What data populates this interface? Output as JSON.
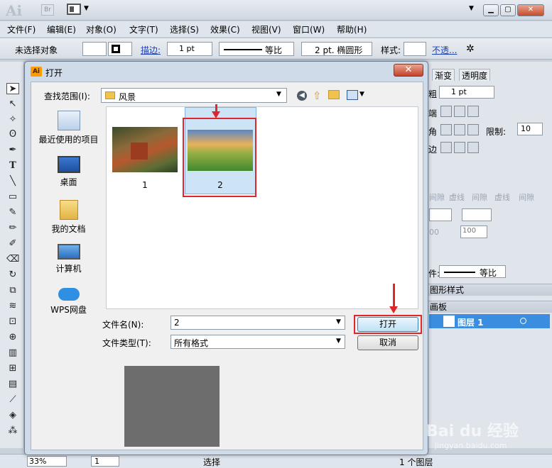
{
  "app": {
    "logo": "Ai",
    "bridge_badge": "Br",
    "window_buttons": [
      "▁",
      "▢",
      "✕"
    ]
  },
  "menu": {
    "items": [
      "文件(F)",
      "编辑(E)",
      "对象(O)",
      "文字(T)",
      "选择(S)",
      "效果(C)",
      "视图(V)",
      "窗口(W)",
      "帮助(H)"
    ]
  },
  "control_bar": {
    "selection_status": "未选择对象",
    "stroke_label": "描边:",
    "stroke_weight": "1 pt",
    "stroke_profile": "等比",
    "brush": "2 pt. 椭圆形",
    "style_label": "样式:",
    "opacity_label": "不透..."
  },
  "right_panel": {
    "tabs": [
      "渐变",
      "透明度"
    ],
    "weight_label": "粗",
    "weight_value": "1 pt",
    "cap_label": "端",
    "corner_label": "角",
    "limit_label": "限制:",
    "limit_value": "10",
    "align_label": "边",
    "dash_labels": [
      "间隙",
      "虚线",
      "间隙",
      "虚线",
      "间隙"
    ],
    "scale_value_1": "00",
    "scale_value_2": "100",
    "profile_label": "件:",
    "profile_value": "等比",
    "graphic_styles_label": "图形样式",
    "artboards_label": "画板",
    "layer_name": "图层 1"
  },
  "status_bar": {
    "zoom": "33%",
    "page": "1",
    "tool": "选择",
    "layers_count": "1 个图层"
  },
  "dialog": {
    "title": "打开",
    "close_label": "✕",
    "look_in_label": "查找范围(I):",
    "look_in_value": "风景",
    "places": [
      "最近使用的项目",
      "桌面",
      "我的文档",
      "计算机",
      "WPS网盘"
    ],
    "files": [
      {
        "name": "1",
        "selected": false
      },
      {
        "name": "2",
        "selected": true
      }
    ],
    "filename_label": "文件名(N):",
    "filename_value": "2",
    "filetype_label": "文件类型(T):",
    "filetype_value": "所有格式",
    "open_button": "打开",
    "cancel_button": "取消"
  },
  "watermark": {
    "brand": "Bai du 经验",
    "url": "jingyan.baidu.com"
  },
  "colors": {
    "highlight_red": "#e0262c",
    "selection_blue": "#3b8ddf"
  }
}
